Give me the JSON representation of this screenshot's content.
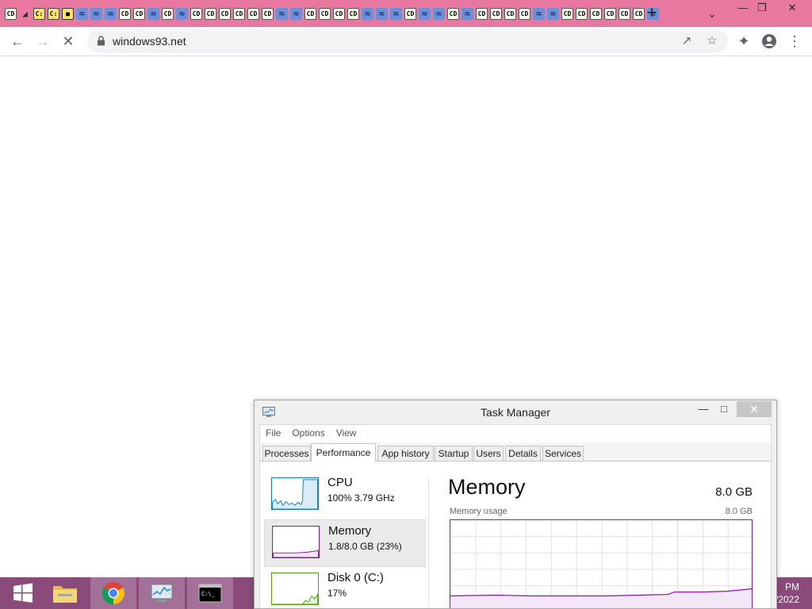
{
  "browser": {
    "tab_favicons": [
      "cd-drive-icon",
      "speaker-icon",
      "cs-exe-icon",
      "cs-exe-icon",
      "image-icon",
      "swirl-icon",
      "swirl-icon",
      "swirl-icon",
      "cd-drive-icon",
      "cd-drive-icon",
      "swirl-icon",
      "cd-drive-icon",
      "swirl-icon",
      "cd-drive-icon",
      "cd-drive-icon",
      "cd-drive-icon",
      "cd-drive-icon",
      "cd-drive-icon",
      "cd-drive-icon",
      "swirl-icon",
      "swirl-icon",
      "cd-drive-icon",
      "cd-drive-icon",
      "cd-drive-icon",
      "cd-drive-icon",
      "swirl-icon",
      "swirl-icon",
      "swirl-icon",
      "cd-drive-icon",
      "swirl-icon",
      "swirl-icon",
      "cd-drive-icon",
      "swirl-icon",
      "cd-drive-icon",
      "cd-drive-icon",
      "cd-drive-icon",
      "cd-drive-icon",
      "swirl-icon",
      "swirl-icon",
      "cd-drive-icon",
      "cd-drive-icon",
      "cd-drive-icon",
      "cd-drive-icon",
      "cd-drive-icon",
      "cd-drive-icon",
      "swirl-icon"
    ],
    "new_tab_label": "+",
    "address": "windows93.net",
    "accent_color": "#e8789f"
  },
  "taskbar": {
    "clock_time": "PM",
    "clock_date": "/2022",
    "color": "#8a4a7a"
  },
  "task_manager": {
    "title": "Task Manager",
    "menus": [
      "File",
      "Options",
      "View"
    ],
    "tabs": [
      "Processes",
      "Performance",
      "App history",
      "Startup",
      "Users",
      "Details",
      "Services"
    ],
    "active_tab": "Performance",
    "perf_items": [
      {
        "name": "CPU",
        "detail": "100%  3.79 GHz",
        "color": "#117dbb"
      },
      {
        "name": "Memory",
        "detail": "1.8/8.0 GB (23%)",
        "color": "#8b12ae"
      },
      {
        "name": "Disk 0 (C:)",
        "detail": "17%",
        "color": "#4da60c"
      }
    ],
    "memory": {
      "heading": "Memory",
      "total": "8.0 GB",
      "usage_label": "Memory usage",
      "usage_max": "8.0 GB",
      "graph_color": "#8b12ae"
    }
  }
}
